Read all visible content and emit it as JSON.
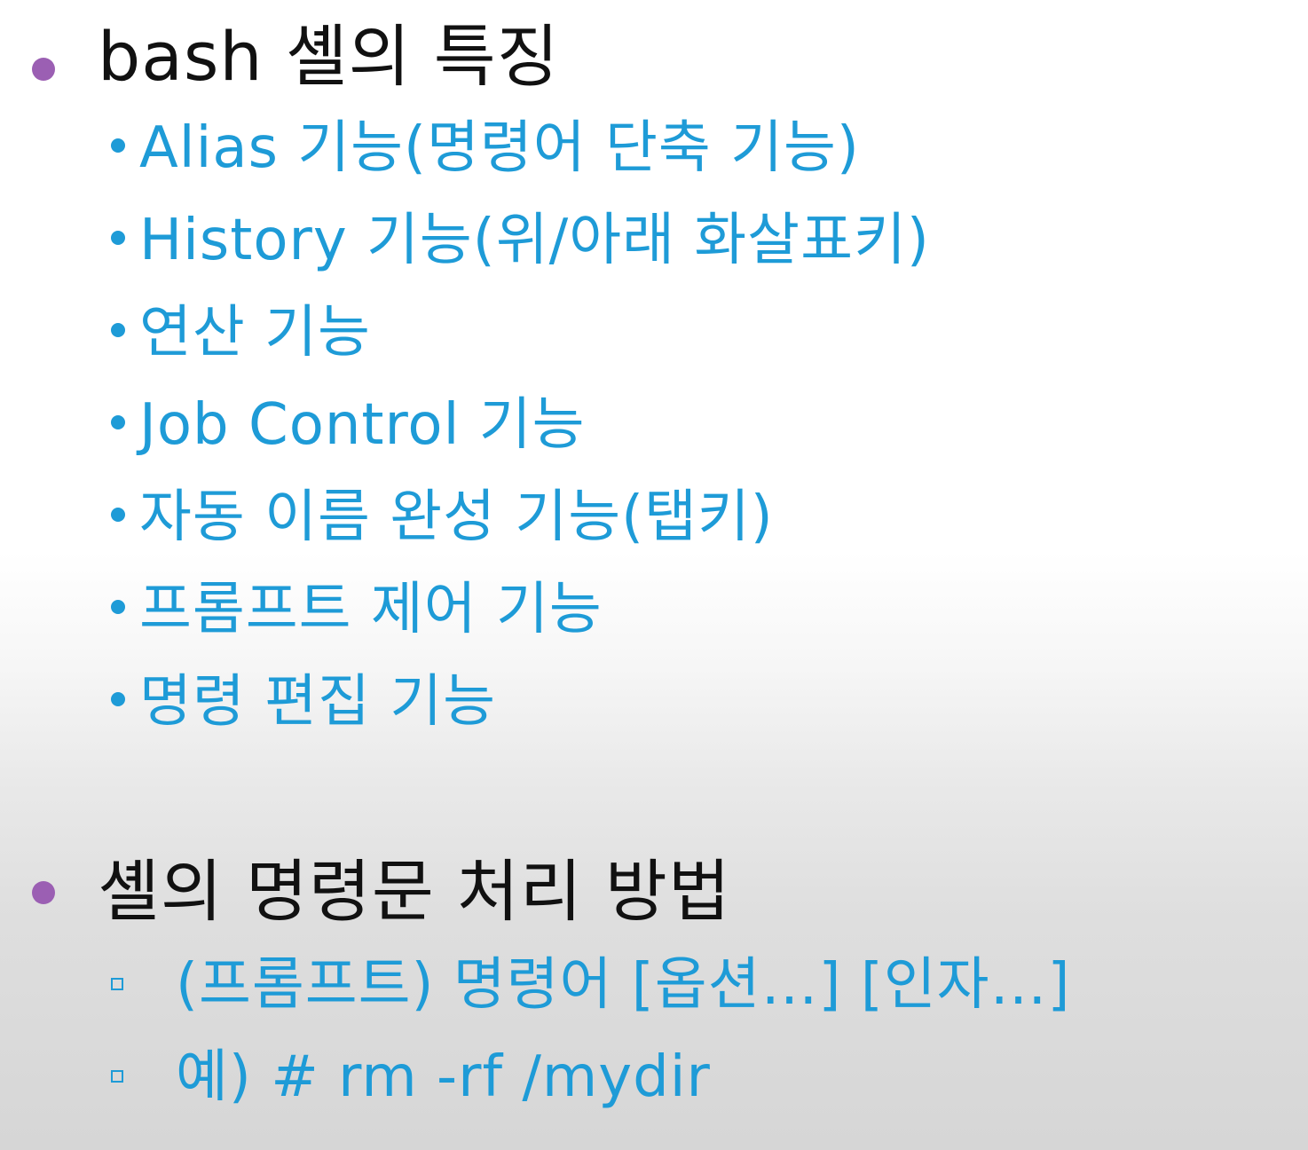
{
  "colors": {
    "heading_text": "#111111",
    "bullet": "#9b5fb3",
    "sub_text": "#1e9bd7"
  },
  "sections": [
    {
      "heading": "bash 셸의 특징",
      "items": [
        "Alias 기능(명령어 단축 기능)",
        "History 기능(위/아래 화살표키)",
        "연산 기능",
        "Job Control 기능",
        "자동 이름 완성 기능(탭키)",
        "프롬프트 제어 기능",
        "명령 편집 기능"
      ]
    },
    {
      "heading": "셸의 명령문 처리 방법",
      "items": [
        "(프롬프트) 명령어 [옵션…] [인자…]",
        "예) # rm -rf /mydir"
      ]
    }
  ]
}
